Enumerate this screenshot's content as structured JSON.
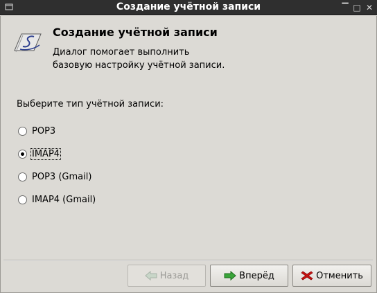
{
  "window": {
    "title": "Создание учётной записи",
    "menu_icon": "window-menu-icon",
    "controls": {
      "minimize": "▔",
      "maximize": "□",
      "close": "✕"
    }
  },
  "header": {
    "icon": "sylpheed-logo-icon",
    "title": "Создание учётной записи",
    "description_line1": "Диалог помогает выполнить",
    "description_line2": "базовую настройку учётной записи."
  },
  "account_type": {
    "prompt": "Выберите тип учётной записи:",
    "options": [
      {
        "label": "POP3",
        "checked": false
      },
      {
        "label": "IMAP4",
        "checked": true
      },
      {
        "label": "POP3 (Gmail)",
        "checked": false
      },
      {
        "label": "IMAP4 (Gmail)",
        "checked": false
      }
    ]
  },
  "buttons": {
    "back": {
      "label": "Назад",
      "icon": "arrow-left-icon",
      "enabled": false
    },
    "next": {
      "label": "Вперёд",
      "icon": "arrow-right-icon",
      "enabled": true
    },
    "cancel": {
      "label": "Отменить",
      "icon": "cancel-icon",
      "enabled": true
    }
  },
  "colors": {
    "titlebar": "#2f2f2f",
    "background": "#dcdad5",
    "next_arrow": "#3aa53a",
    "cancel_red": "#cc1111"
  }
}
